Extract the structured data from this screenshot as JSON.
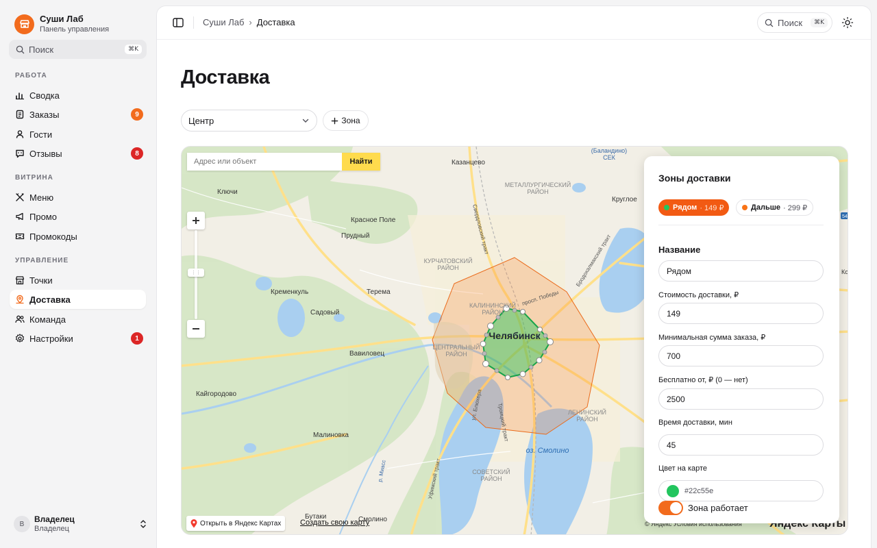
{
  "brand": {
    "name": "Суши Лаб",
    "subtitle": "Панель управления"
  },
  "sidebar": {
    "search": {
      "label": "Поиск",
      "shortcut": "⌘K"
    },
    "sections": {
      "work": "РАБОТА",
      "storefront": "ВИТРИНА",
      "management": "УПРАВЛЕНИЕ"
    },
    "items": {
      "summary": "Сводка",
      "orders": "Заказы",
      "orders_badge": "9",
      "guests": "Гости",
      "reviews": "Отзывы",
      "reviews_badge": "8",
      "menu": "Меню",
      "promo": "Промо",
      "promocodes": "Промокоды",
      "points": "Точки",
      "delivery": "Доставка",
      "team": "Команда",
      "settings": "Настройки",
      "settings_badge": "1"
    },
    "user": {
      "initial": "В",
      "name": "Владелец",
      "role": "Владелец"
    }
  },
  "topbar": {
    "breadcrumb": [
      "Суши Лаб",
      "Доставка"
    ],
    "search_label": "Поиск",
    "search_shortcut": "⌘K"
  },
  "page": {
    "title": "Доставка",
    "zone_select_value": "Центр",
    "add_zone_label": "Зона"
  },
  "map": {
    "search_placeholder": "Адрес или объект",
    "search_button": "Найти",
    "open_in_ymaps": "Открыть в Яндекс Картах",
    "create_map": "Создать свою карту",
    "copyright": "© Яндекс Условия использования",
    "logo": "Яндекс Карты",
    "labels": {
      "city": "Челябинск",
      "kazantsevo": "Казанцево",
      "klyuchi": "Ключи",
      "krasnoe_pole": "Красное Поле",
      "prudny": "Прудный",
      "kremenkul": "Кременкуль",
      "terema": "Терема",
      "sadovy": "Садовый",
      "vavilovets": "Вавиловец",
      "kaygorodovo": "Кайгородово",
      "malinovka": "Малиновка",
      "krugloe": "Круглое",
      "butaki": "Бутаки",
      "smolino_village": "Смолино",
      "lake_smolino": "оз. Смолино",
      "metallurg_1": "МЕТАЛЛУРГИЧЕСКИЙ",
      "metallurg_2": "РАЙОН",
      "kurchat_1": "КУРЧАТОВСКИЙ",
      "kurchat_2": "РАЙОН",
      "kalinin_1": "КАЛИНИНСКИЙ",
      "kalinin_2": "РАЙОН",
      "central_1": "ЦЕНТРАЛЬНЫЙ",
      "central_2": "РАЙОН",
      "lenin_1": "ЛЕНИНСКИЙ",
      "lenin_2": "РАЙОН",
      "soviet_1": "СОВЕТСКИЙ",
      "soviet_2": "РАЙОН",
      "balandino_1": "(Баландино)",
      "balandino_2": "СЕК",
      "pobedy": "просп. Победы",
      "sverdlovsky": "Свердловский тракт",
      "brodokalmak": "Бродокалмакский тракт",
      "troitsky": "Троицкий тракт",
      "ufimsky": "Уфимский тракт",
      "blukher": "ул. Блюхера",
      "miass": "р. Миасс",
      "shield_54": "54",
      "edge_ko": "Ко"
    }
  },
  "zones_panel": {
    "title": "Зоны доставки",
    "chips": [
      {
        "name": "Рядом",
        "price": "· 149 ₽",
        "color": "#22c55e"
      },
      {
        "name": "Дальше",
        "price": "· 299 ₽",
        "color": "#f97316"
      }
    ],
    "name_label": "Название",
    "name_value": "Рядом",
    "cost_label": "Стоимость доставки, ₽",
    "cost_value": "149",
    "min_label": "Минимальная сумма заказа, ₽",
    "min_value": "700",
    "free_label": "Бесплатно от, ₽ (0 — нет)",
    "free_value": "2500",
    "time_label": "Время доставки, мин",
    "time_value": "45",
    "color_label": "Цвет на карте",
    "color_value": "#22c55e",
    "active_label": "Зона работает"
  },
  "colors": {
    "accent": "#f26b1d",
    "badge_orange": "#f26b1d",
    "badge_red": "#dc2626",
    "near_zone": "#22c55e",
    "far_zone": "#f97316"
  }
}
